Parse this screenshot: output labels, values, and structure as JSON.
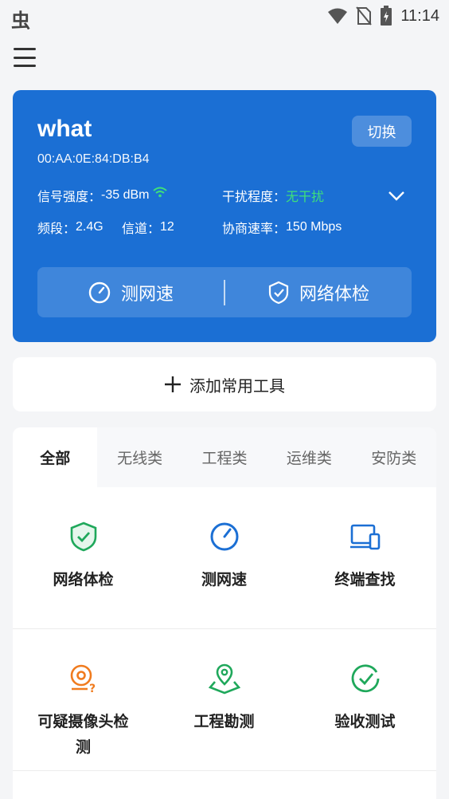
{
  "status_bar": {
    "left_glyph": "虫",
    "time": "11:14",
    "icons": [
      "wifi-icon",
      "no-sim-icon",
      "battery-charging-icon"
    ]
  },
  "network": {
    "ssid": "what",
    "mac": "00:AA:0E:84:DB:B4",
    "switch_label": "切换",
    "signal_label": "信号强度：",
    "signal_value": "-35 dBm",
    "interference_label": "干扰程度：",
    "interference_value": "无干扰",
    "band_label": "频段：",
    "band_value": "2.4G",
    "channel_label": "信道：",
    "channel_value": "12",
    "rate_label": "协商速率：",
    "rate_value": "150 Mbps",
    "speed_test_label": "测网速",
    "health_check_label": "网络体检"
  },
  "add_tools_label": "添加常用工具",
  "tabs": [
    "全部",
    "无线类",
    "工程类",
    "运维类",
    "安防类"
  ],
  "tools": [
    {
      "label": "网络体检",
      "icon": "shield-check-icon",
      "color": "#1fa85b"
    },
    {
      "label": "测网速",
      "icon": "speedometer-icon",
      "color": "#1b6fd4"
    },
    {
      "label": "终端查找",
      "icon": "devices-icon",
      "color": "#1b6fd4"
    },
    {
      "label": "可疑摄像头检测",
      "icon": "camera-question-icon",
      "color": "#f07b1e"
    },
    {
      "label": "工程勘测",
      "icon": "map-pin-icon",
      "color": "#1fa85b"
    },
    {
      "label": "验收测试",
      "icon": "check-circle-icon",
      "color": "#1fa85b"
    }
  ],
  "colors": {
    "primary": "#1b6fd4",
    "green": "#3ee07a",
    "accent_green": "#1fa85b",
    "accent_orange": "#f07b1e"
  }
}
